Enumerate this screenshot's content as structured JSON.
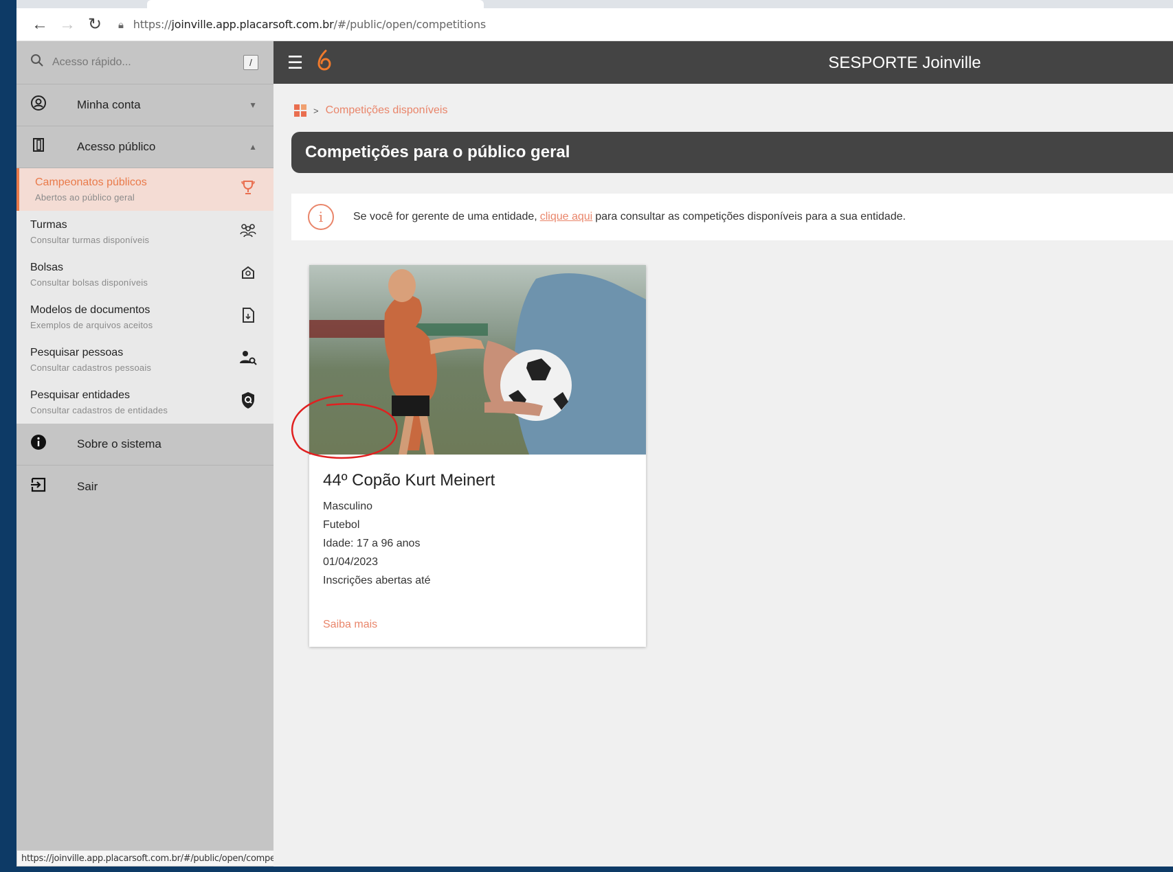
{
  "browser": {
    "url_prefix": "https://",
    "url_host": "joinville.app.placarsoft.com.br",
    "url_path": "/#/public/open/competitions",
    "status_url": "https://joinville.app.placarsoft.com.br/#/public/open/competitions"
  },
  "sidebar": {
    "search_placeholder": "Acesso rápido...",
    "search_shortcut": "/",
    "sections": {
      "account": "Minha conta",
      "public": "Acesso público",
      "about": "Sobre o sistema",
      "logout": "Sair"
    },
    "items": [
      {
        "title": "Campeonatos públicos",
        "subtitle": "Abertos ao público geral",
        "icon": "trophy-icon",
        "active": true
      },
      {
        "title": "Turmas",
        "subtitle": "Consultar turmas disponíveis",
        "icon": "group-icon"
      },
      {
        "title": "Bolsas",
        "subtitle": "Consultar bolsas disponíveis",
        "icon": "scholarship-icon"
      },
      {
        "title": "Modelos de documentos",
        "subtitle": "Exemplos de arquivos aceitos",
        "icon": "document-icon"
      },
      {
        "title": "Pesquisar pessoas",
        "subtitle": "Consultar cadastros pessoais",
        "icon": "person-search-icon"
      },
      {
        "title": "Pesquisar entidades",
        "subtitle": "Consultar cadastros de entidades",
        "icon": "entity-search-icon"
      }
    ]
  },
  "header": {
    "title": "SESPORTE Joinville"
  },
  "breadcrumb": {
    "current": "Competições disponíveis"
  },
  "page": {
    "title": "Competições para o público geral",
    "info_before": "Se você for gerente de uma entidade, ",
    "info_link": "clique aqui",
    "info_after": " para consultar as competições disponíveis para a sua entidade."
  },
  "card": {
    "title": "44º Copão Kurt Meinert",
    "gender": "Masculino",
    "sport": "Futebol",
    "age": "Idade: 17 a 96 anos",
    "date": "01/04/2023",
    "registration": "Inscrições abertas até",
    "link": "Saiba mais"
  },
  "colors": {
    "accent": "#e9856a",
    "header": "#444444",
    "sidebar": "#c5c5c5",
    "annotation": "#e02020"
  }
}
